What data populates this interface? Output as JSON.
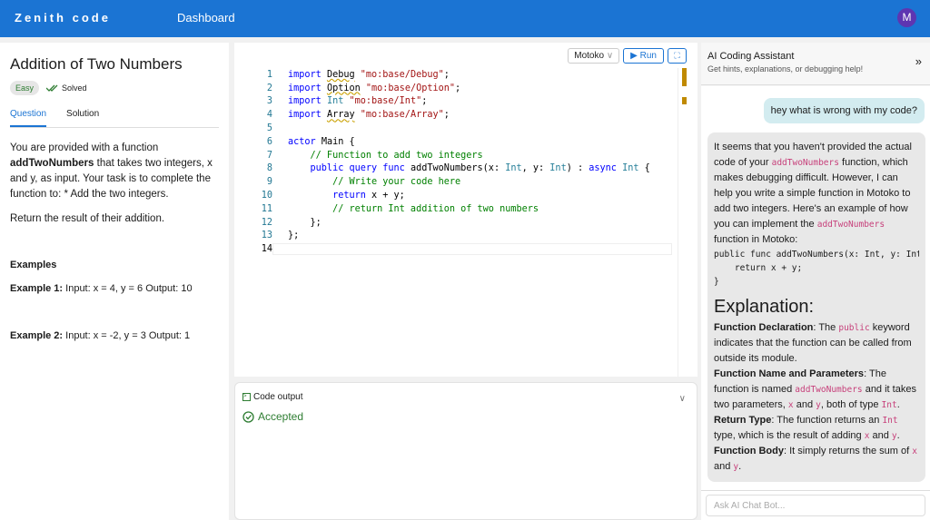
{
  "header": {
    "brand": "Zenith code",
    "nav": "Dashboard",
    "avatar": "M"
  },
  "problem": {
    "title": "Addition of Two Numbers",
    "difficulty": "Easy",
    "status": "Solved",
    "tabs": [
      "Question",
      "Solution"
    ],
    "desc_pre": "You are provided with a function ",
    "desc_fn": "addTwoNumbers",
    "desc_post": " that takes two integers, x and y, as input. Your task is to complete the function to: * Add the two integers.",
    "desc2": "Return the result of their addition.",
    "examples_heading": "Examples",
    "examples": [
      {
        "label": "Example 1:",
        "text": " Input: x = 4, y = 6 Output: 10"
      },
      {
        "label": "Example 2:",
        "text": " Input: x = -2, y = 3 Output: 1"
      }
    ]
  },
  "editor": {
    "language": "Motoko",
    "run": "Run",
    "lines": [
      [
        [
          "import ",
          "kw"
        ],
        [
          "Debug",
          "plain wavy"
        ],
        [
          " \"mo:base/Debug\"",
          "str"
        ],
        [
          ";",
          "plain"
        ]
      ],
      [
        [
          "import ",
          "kw"
        ],
        [
          "Option",
          "plain wavy"
        ],
        [
          " \"mo:base/Option\"",
          "str"
        ],
        [
          ";",
          "plain"
        ]
      ],
      [
        [
          "import ",
          "kw"
        ],
        [
          "Int",
          "typ"
        ],
        [
          " \"mo:base/Int\"",
          "str"
        ],
        [
          ";",
          "plain"
        ]
      ],
      [
        [
          "import ",
          "kw"
        ],
        [
          "Array",
          "plain wavy"
        ],
        [
          " \"mo:base/Array\"",
          "str"
        ],
        [
          ";",
          "plain"
        ]
      ],
      [],
      [
        [
          "actor ",
          "kw"
        ],
        [
          "Main {",
          "plain"
        ]
      ],
      [
        [
          "    // Function to add two integers",
          "com"
        ]
      ],
      [
        [
          "    public query func ",
          "kw"
        ],
        [
          "addTwoNumbers(x: ",
          "plain"
        ],
        [
          "Int",
          "typ"
        ],
        [
          ", y: ",
          "plain"
        ],
        [
          "Int",
          "typ"
        ],
        [
          ") : ",
          "plain"
        ],
        [
          "async ",
          "kw"
        ],
        [
          "Int",
          "typ"
        ],
        [
          " {",
          "plain"
        ]
      ],
      [
        [
          "        // Write your code here",
          "com"
        ]
      ],
      [
        [
          "        return ",
          "kw"
        ],
        [
          "x + y;",
          "plain"
        ]
      ],
      [
        [
          "        // return Int addition of two numbers",
          "com"
        ]
      ],
      [
        [
          "    };",
          "plain"
        ]
      ],
      [
        [
          "};",
          "plain"
        ]
      ],
      []
    ]
  },
  "output": {
    "title": "Code output",
    "status": "Accepted"
  },
  "assistant": {
    "title": "AI Coding Assistant",
    "subtitle": "Get hints, explanations, or debugging help!",
    "user_message": "hey what is wrong with my code?",
    "reply": [
      {
        "type": "p",
        "segs": [
          [
            "It seems that you haven't provided the actual code of your ",
            "t"
          ],
          [
            "addTwoNumbers",
            "c"
          ],
          [
            " function, which makes debugging difficult. However, I can help you write a simple function in Motoko to add two integers. Here's an example of how you can implement the ",
            "t"
          ],
          [
            "addTwoNumbers",
            "c"
          ],
          [
            " function in Motoko:",
            "t"
          ]
        ]
      },
      {
        "type": "pre",
        "text": "public func addTwoNumbers(x: Int, y: Int) : Int {\n    return x + y;\n}"
      },
      {
        "type": "h",
        "text": "Explanation:"
      },
      {
        "type": "p",
        "segs": [
          [
            "Function Declaration",
            "b"
          ],
          [
            ": The ",
            "t"
          ],
          [
            "public",
            "c"
          ],
          [
            " keyword indicates that the function can be called from outside its module.",
            "t"
          ]
        ]
      },
      {
        "type": "p",
        "segs": [
          [
            "Function Name and Parameters",
            "b"
          ],
          [
            ": The function is named ",
            "t"
          ],
          [
            "addTwoNumbers",
            "c"
          ],
          [
            " and it takes two parameters, ",
            "t"
          ],
          [
            "x",
            "c"
          ],
          [
            " and ",
            "t"
          ],
          [
            "y",
            "c"
          ],
          [
            ", both of type ",
            "t"
          ],
          [
            "Int",
            "c"
          ],
          [
            ".",
            "t"
          ]
        ]
      },
      {
        "type": "p",
        "segs": [
          [
            "Return Type",
            "b"
          ],
          [
            ": The function returns an ",
            "t"
          ],
          [
            "Int",
            "c"
          ],
          [
            " type, which is the result of adding ",
            "t"
          ],
          [
            "x",
            "c"
          ],
          [
            " and ",
            "t"
          ],
          [
            "y",
            "c"
          ],
          [
            ".",
            "t"
          ]
        ]
      },
      {
        "type": "p",
        "segs": [
          [
            "Function Body",
            "b"
          ],
          [
            ": It simply returns the sum of ",
            "t"
          ],
          [
            "x",
            "c"
          ],
          [
            " and ",
            "t"
          ],
          [
            "y",
            "c"
          ],
          [
            ".",
            "t"
          ]
        ]
      }
    ],
    "input_placeholder": "Ask AI Chat Bot..."
  }
}
